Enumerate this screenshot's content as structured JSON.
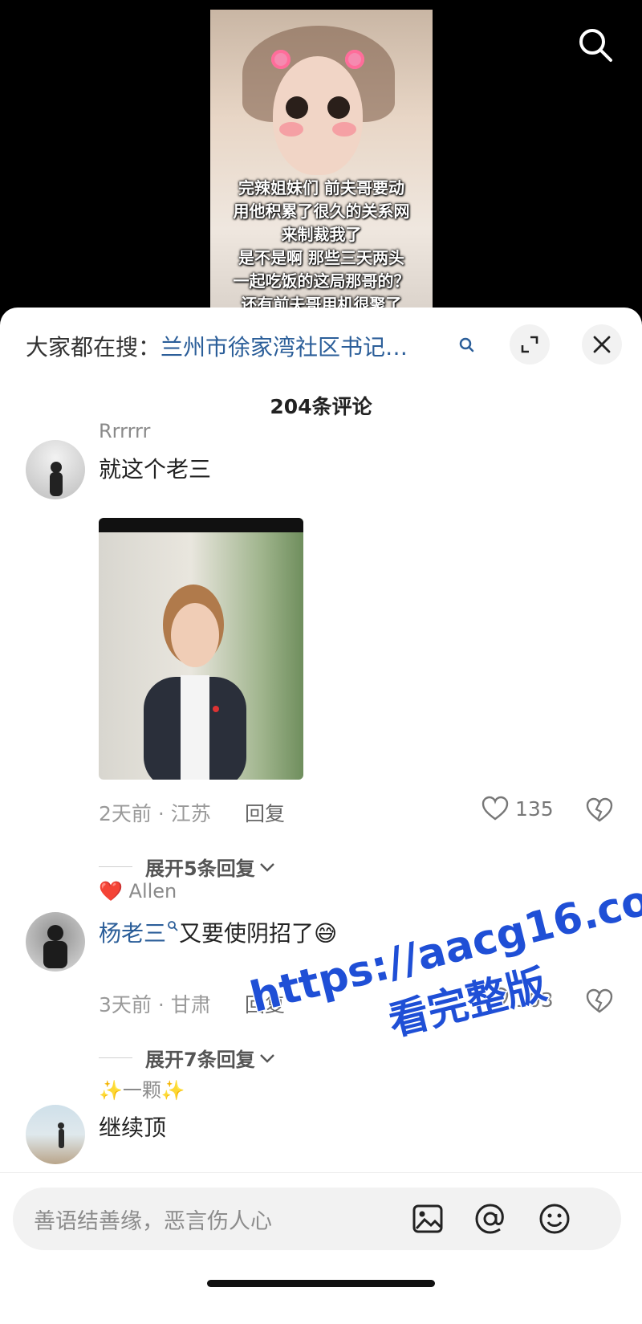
{
  "video": {
    "subtitle_lines": [
      "完辣姐妹们 前夫哥要动",
      "用他积累了很久的关系网",
      "来制裁我了",
      "是不是啊 那些三天两头",
      "一起吃饭的这局那哥的？",
      "还有前夫哥用机很聚了"
    ]
  },
  "header": {
    "hot_search_prefix": "大家都在搜：",
    "hot_search_term": "兰州市徐家湾社区书记…",
    "comment_count": "204条评论"
  },
  "comments": [
    {
      "username": "Rrrrrr",
      "text": "就这个老三",
      "meta": "2天前 · 江苏",
      "reply_label": "回复",
      "likes": "135",
      "expand_label": "展开5条回复"
    },
    {
      "username_heart": "❤️",
      "username": "Allen",
      "mention": "杨老三",
      "text": "又要使阴招了",
      "emoji": "😅",
      "meta": "3天前 · 甘肃",
      "reply_label": "回复",
      "likes": "103",
      "expand_label": "展开7条回复"
    },
    {
      "username": "✨一颗✨",
      "text": "继续顶"
    }
  ],
  "input": {
    "placeholder": "善语结善缘，恶言伤人心"
  },
  "watermark": {
    "line1": "https://aacg16.com",
    "line2": "看完整版"
  },
  "colors": {
    "link": "#2b5e99",
    "watermark": "#1f4fd6"
  }
}
